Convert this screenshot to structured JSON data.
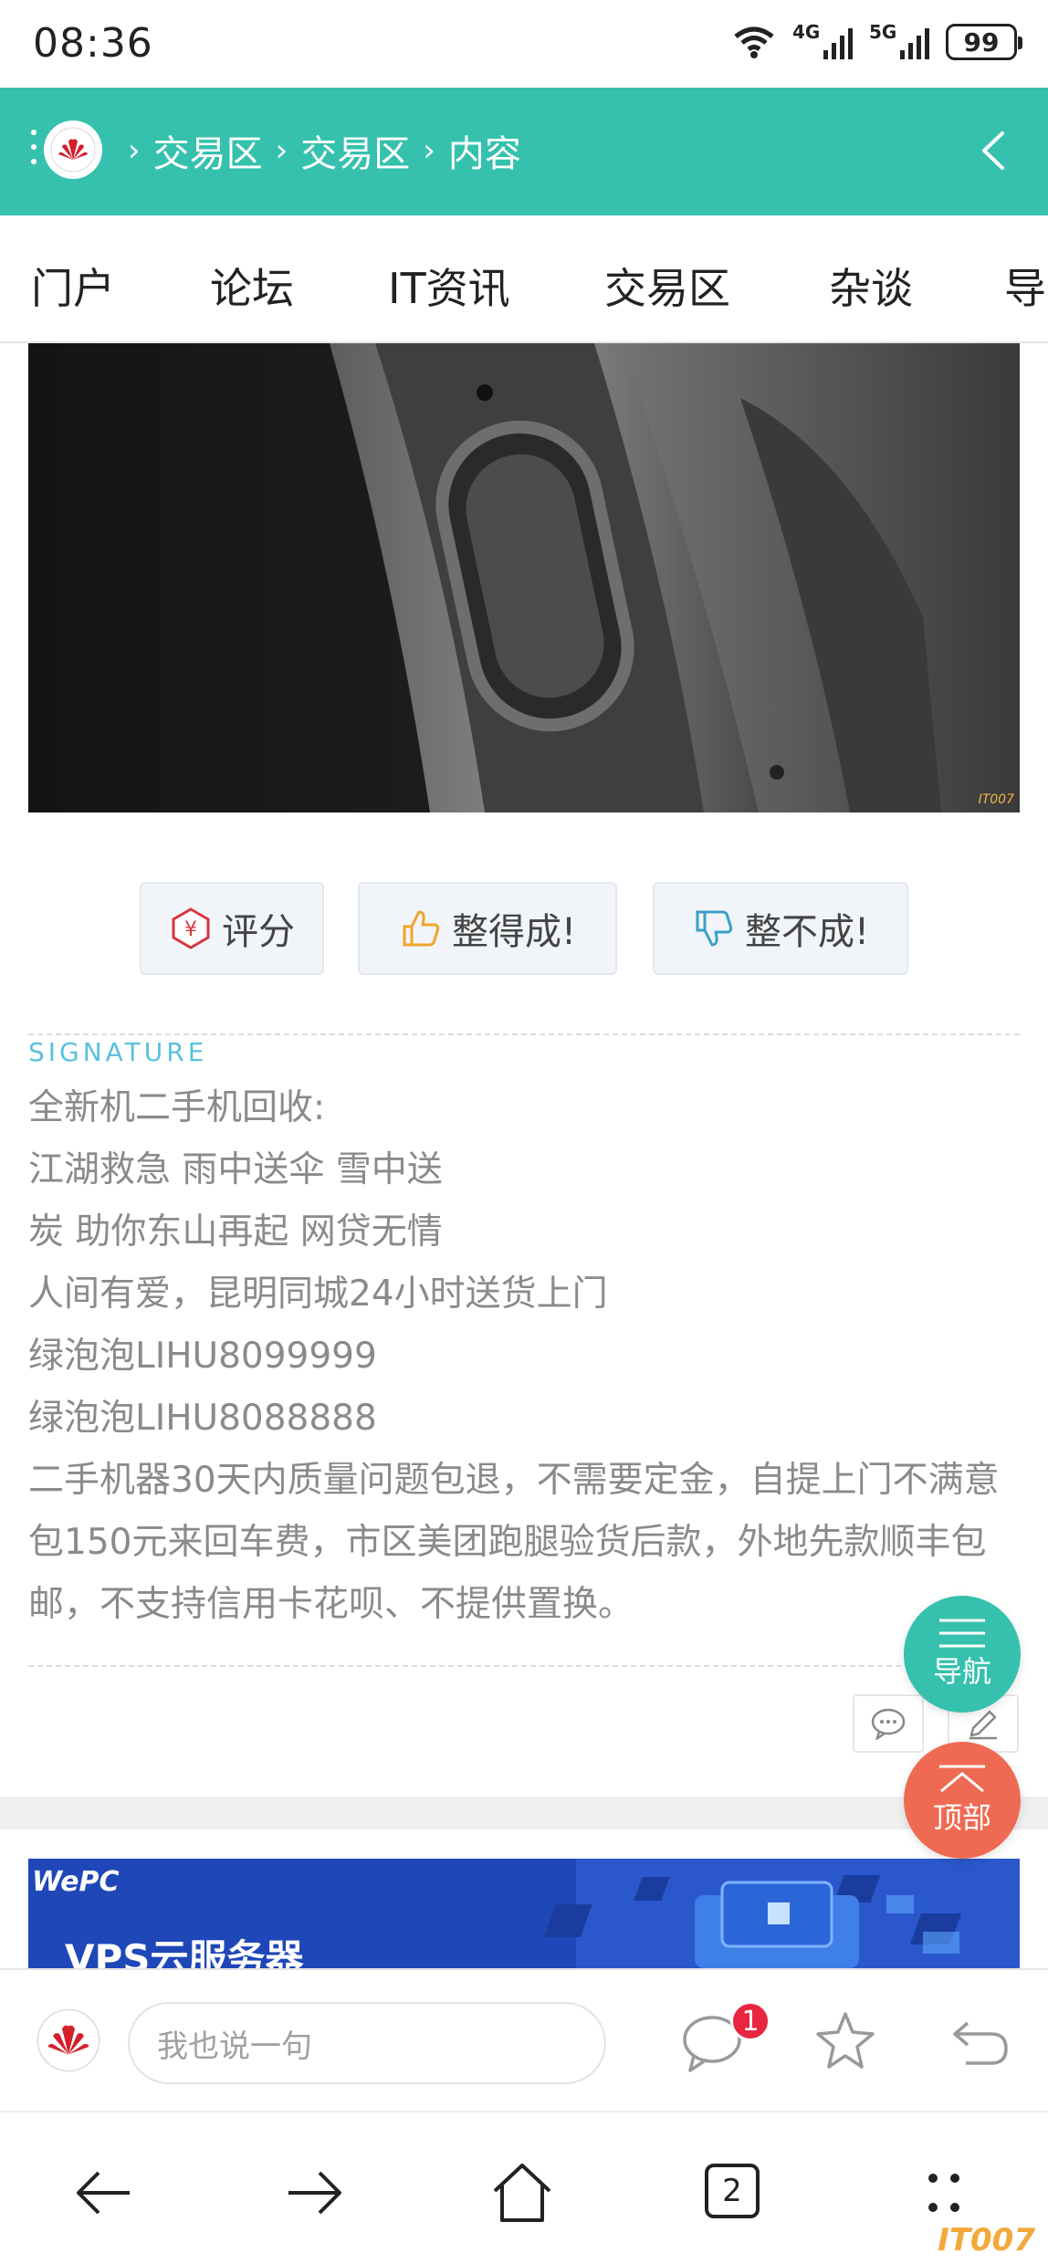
{
  "status_bar": {
    "time": "08:36",
    "network_1": "4G",
    "network_2": "5G",
    "battery": "99"
  },
  "header": {
    "breadcrumb": [
      "交易区",
      "交易区",
      "内容"
    ]
  },
  "nav_tabs": [
    "门户",
    "论坛",
    "IT资讯",
    "交易区",
    "杂谈",
    "导"
  ],
  "post_actions": {
    "rate_label": "评分",
    "like_label": "整得成!",
    "dislike_label": "整不成!"
  },
  "signature": {
    "heading": "SIGNATURE",
    "lines": [
      "全新机二手机回收:",
      "江湖救急 雨中送伞 雪中送",
      "炭 助你东山再起 网贷无情",
      "人间有爱，昆明同城24小时送货上门",
      "绿泡泡LIHU8099999",
      "绿泡泡LIHU8088888",
      "二手机器30天内质量问题包退，不需要定金，自提上门不满意包150元来回车费，市区美团跑腿验货后款，外地先款顺丰包邮，不支持信用卡花呗、不提供置换。"
    ]
  },
  "banner": {
    "brand": "WePC",
    "title": "VPS云服务器"
  },
  "floating": {
    "nav_label": "导航",
    "top_label": "顶部"
  },
  "comment_bar": {
    "placeholder": "我也说一句",
    "comment_count": "1"
  },
  "system_nav": {
    "tab_count": "2"
  },
  "watermark": "IT007",
  "colors": {
    "header_teal": "#35c1ad",
    "top_button": "#ef6a52",
    "badge_red": "#e8263f",
    "signature_heading": "#5bc0de"
  }
}
